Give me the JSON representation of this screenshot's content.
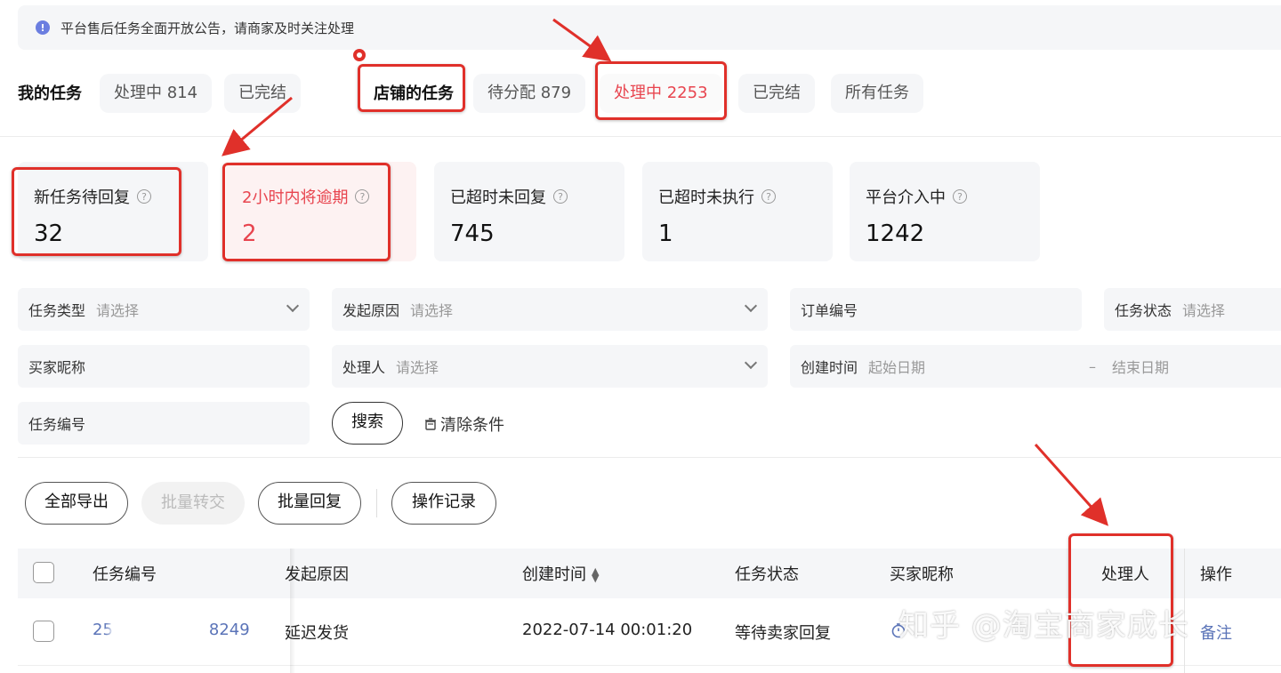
{
  "notice": {
    "icon": "info-icon",
    "text": "平台售后任务全面开放公告，请商家及时关注处理"
  },
  "my_tasks": {
    "label": "我的任务",
    "tabs": [
      {
        "label": "处理中 814"
      },
      {
        "label": "已完结"
      }
    ]
  },
  "shop_tasks": {
    "label": "店铺的任务",
    "tabs": [
      {
        "label": "待分配 879"
      },
      {
        "label": "处理中 2253"
      },
      {
        "label": "已完结"
      },
      {
        "label": "所有任务"
      }
    ]
  },
  "stats": [
    {
      "title": "新任务待回复",
      "value": "32"
    },
    {
      "title": "2小时内将逾期",
      "value": "2"
    },
    {
      "title": "已超时未回复",
      "value": "745"
    },
    {
      "title": "已超时未执行",
      "value": "1"
    },
    {
      "title": "平台介入中",
      "value": "1242"
    }
  ],
  "help_icon_glyph": "?",
  "filters": {
    "task_type": {
      "label": "任务类型",
      "placeholder": "请选择"
    },
    "reason": {
      "label": "发起原因",
      "placeholder": "请选择"
    },
    "order_no": {
      "label": "订单编号"
    },
    "task_status": {
      "label": "任务状态",
      "placeholder": "请选择"
    },
    "buyer_nick": {
      "label": "买家昵称"
    },
    "handler": {
      "label": "处理人",
      "placeholder": "请选择"
    },
    "created": {
      "label": "创建时间",
      "start": "起始日期",
      "sep": "–",
      "end": "结束日期"
    },
    "task_no": {
      "label": "任务编号"
    }
  },
  "actions": {
    "search": "搜索",
    "clear": "清除条件"
  },
  "toolbar": {
    "export_all": "全部导出",
    "batch_transfer": "批量转交",
    "batch_reply": "批量回复",
    "op_log": "操作记录"
  },
  "table": {
    "headers": [
      "任务编号",
      "发起原因",
      "创建时间",
      "任务状态",
      "买家昵称",
      "处理人",
      "操作"
    ],
    "rows": [
      {
        "task_no": "25",
        "task_no_tail": "8249",
        "reason": "延迟发货",
        "created": "2022-07-14 00:01:20",
        "status": "等待卖家回复",
        "action": "备注"
      }
    ]
  },
  "watermark": "知乎 @淘宝商家成长",
  "colors": {
    "accent_red": "#e8454f",
    "annotation_red": "#e0302a",
    "link_blue": "#5b74b8"
  }
}
